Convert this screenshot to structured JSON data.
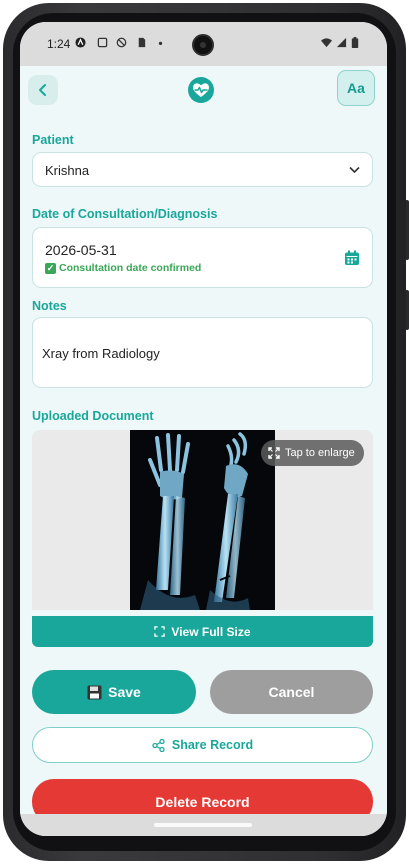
{
  "status_bar": {
    "time": "1:24"
  },
  "header": {
    "back_icon": "chevron-left-icon",
    "logo_icon": "heart-pulse-icon",
    "font_size_button": "Aa"
  },
  "patient": {
    "label": "Patient",
    "value": "Krishna"
  },
  "date": {
    "label": "Date of Consultation/Diagnosis",
    "value": "2026-05-31",
    "status": "Consultation date confirmed",
    "status_icon": "check-box-icon",
    "calendar_icon": "calendar-icon"
  },
  "notes": {
    "label": "Notes",
    "value": "Xray from Radiology"
  },
  "document": {
    "label": "Uploaded Document",
    "tap_to_enlarge": "Tap to enlarge",
    "view_full_size": "View Full Size"
  },
  "actions": {
    "save": "Save",
    "cancel": "Cancel",
    "share": "Share Record",
    "delete": "Delete Record"
  },
  "colors": {
    "accent": "#1aa79b",
    "background": "#eef8f8",
    "delete": "#e53935",
    "cancel": "#9e9e9e",
    "confirm": "#3aa657"
  }
}
